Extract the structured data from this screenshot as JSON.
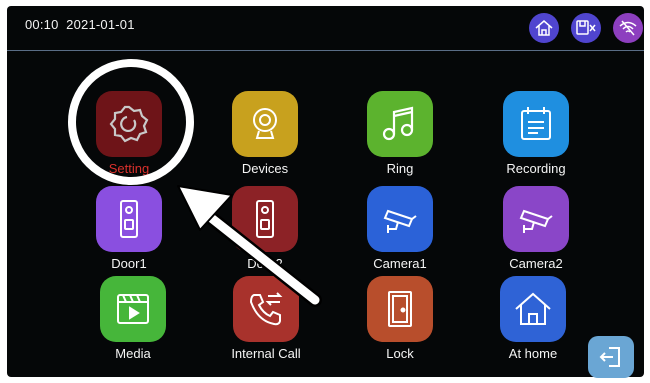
{
  "status_bar": {
    "time": "00:10",
    "date": "2021-01-01",
    "icons": [
      "home-icon",
      "mute-icon",
      "wifi-off-icon"
    ]
  },
  "apps": [
    {
      "label": "Setting",
      "icon": "gear-icon",
      "color": "#6e1418"
    },
    {
      "label": "Devices",
      "icon": "webcam-icon",
      "color": "#c8a11e"
    },
    {
      "label": "Ring",
      "icon": "music-note-icon",
      "color": "#5cb32e"
    },
    {
      "label": "Recording",
      "icon": "calendar-list-icon",
      "color": "#1f8fe0"
    },
    {
      "label": "Door1",
      "icon": "doorbell-icon",
      "color": "#8a4fe0"
    },
    {
      "label": "Door2",
      "icon": "doorbell-icon",
      "color": "#8c2226"
    },
    {
      "label": "Camera1",
      "icon": "cctv-camera-icon",
      "color": "#2b62d8"
    },
    {
      "label": "Camera2",
      "icon": "cctv-camera-icon",
      "color": "#8a46c8"
    },
    {
      "label": "Media",
      "icon": "film-play-icon",
      "color": "#46b63a"
    },
    {
      "label": "Internal Call",
      "icon": "phone-transfer-icon",
      "color": "#a8322c"
    },
    {
      "label": "Lock",
      "icon": "door-icon",
      "color": "#b84e2c"
    },
    {
      "label": "At home",
      "icon": "house-icon",
      "color": "#2f63d6"
    }
  ],
  "back_icon": "logout-icon",
  "colors": {
    "accent_purple": "#5a4ad6",
    "screen_bg": "#050708",
    "highlight_ring": "#ffffff"
  }
}
